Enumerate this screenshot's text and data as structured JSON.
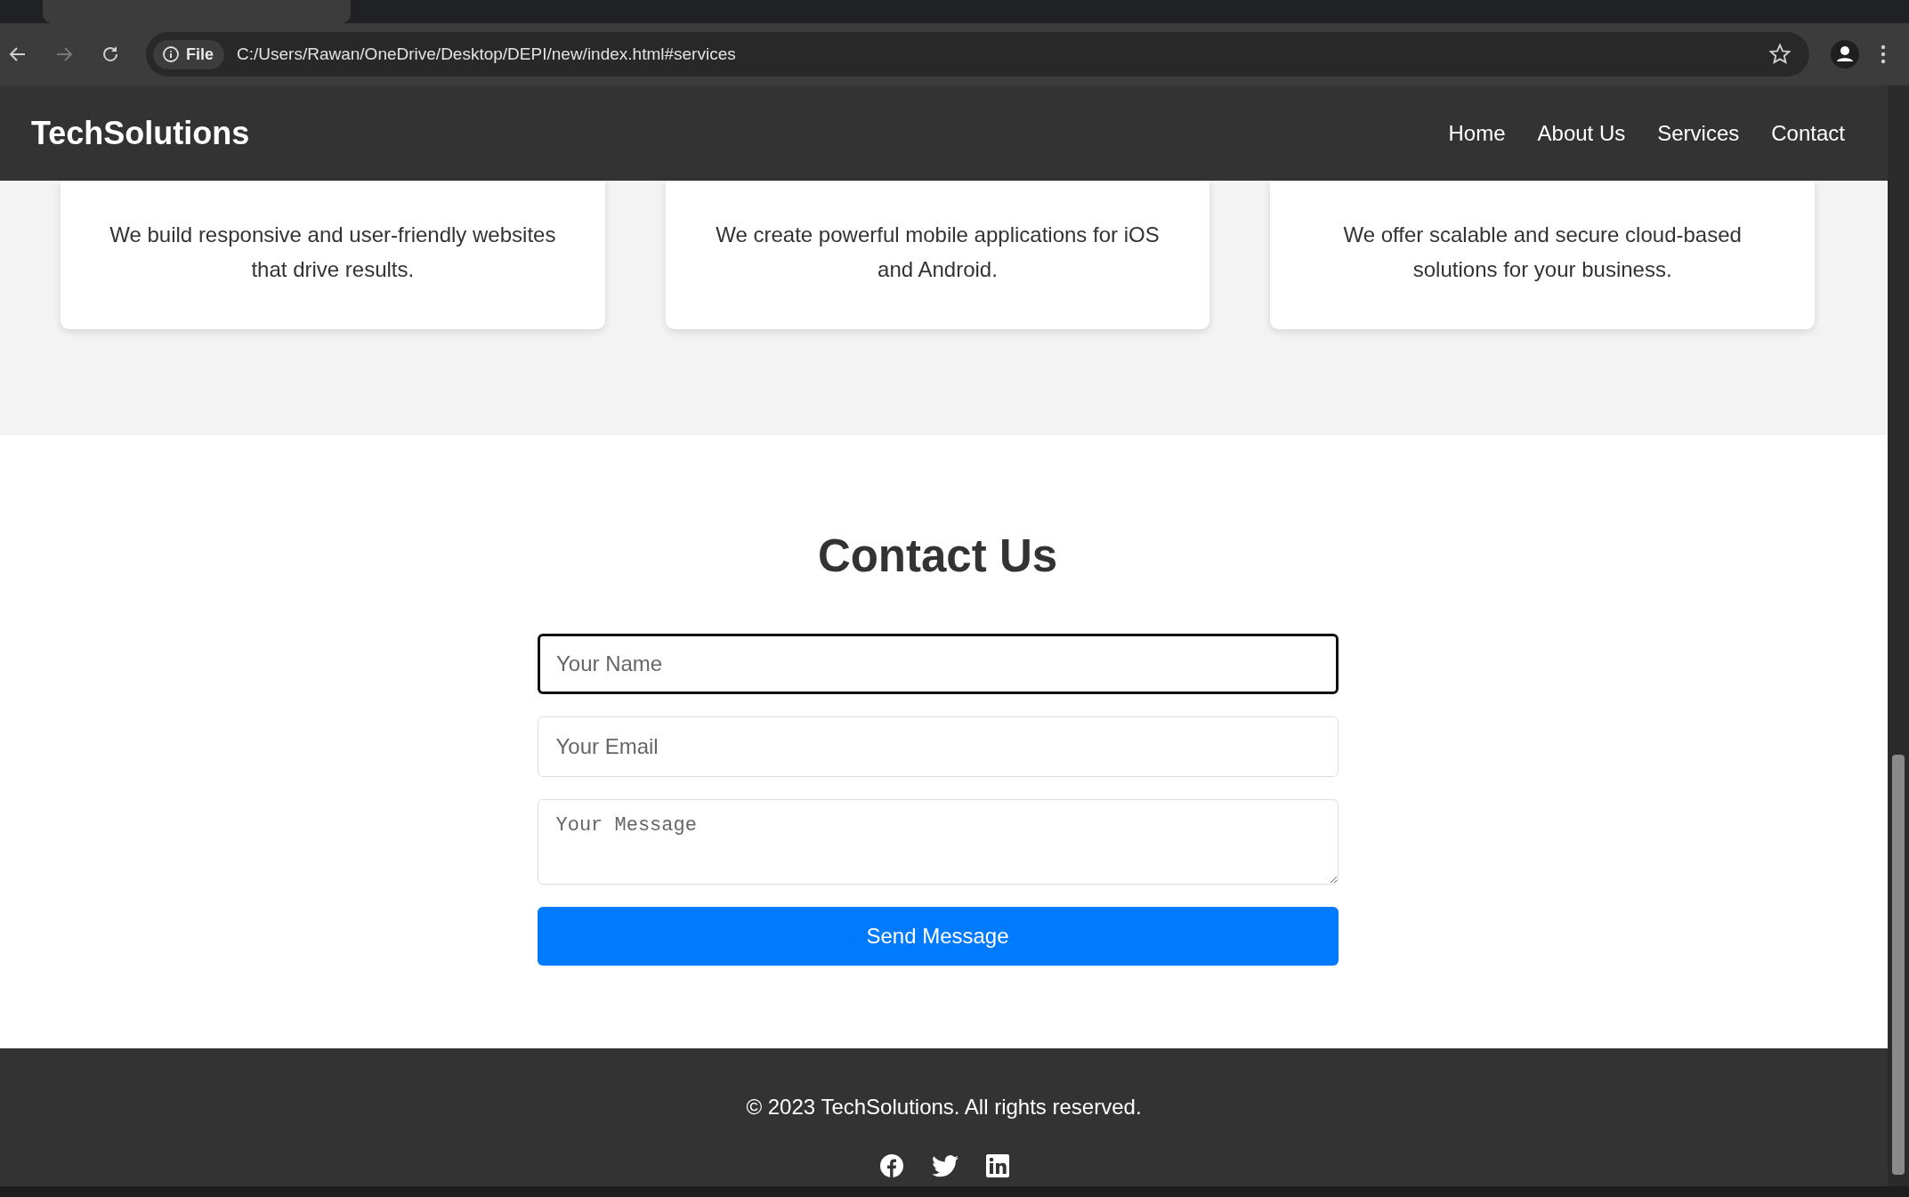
{
  "browser": {
    "address_chip": "File",
    "url": "C:/Users/Rawan/OneDrive/Desktop/DEPI/new/index.html#services",
    "forward_disabled": true
  },
  "navbar": {
    "brand": "TechSolutions",
    "links": [
      {
        "label": "Home"
      },
      {
        "label": "About Us"
      },
      {
        "label": "Services"
      },
      {
        "label": "Contact"
      }
    ]
  },
  "services": [
    {
      "description": "We build responsive and user-friendly websites that drive results."
    },
    {
      "description": "We create powerful mobile applications for iOS and Android."
    },
    {
      "description": "We offer scalable and secure cloud-based solutions for your business."
    }
  ],
  "contact": {
    "title": "Contact Us",
    "fields": [
      {
        "kind": "input",
        "placeholder": "Your Name",
        "focused": true
      },
      {
        "kind": "input",
        "placeholder": "Your Email",
        "focused": false
      },
      {
        "kind": "textarea",
        "placeholder": "Your Message",
        "focused": false
      }
    ],
    "submit": "Send Message"
  },
  "footer": {
    "copyright": "© 2023 TechSolutions. All rights reserved.",
    "social": [
      {
        "kind": "facebook"
      },
      {
        "kind": "twitter"
      },
      {
        "kind": "linkedin"
      }
    ]
  }
}
